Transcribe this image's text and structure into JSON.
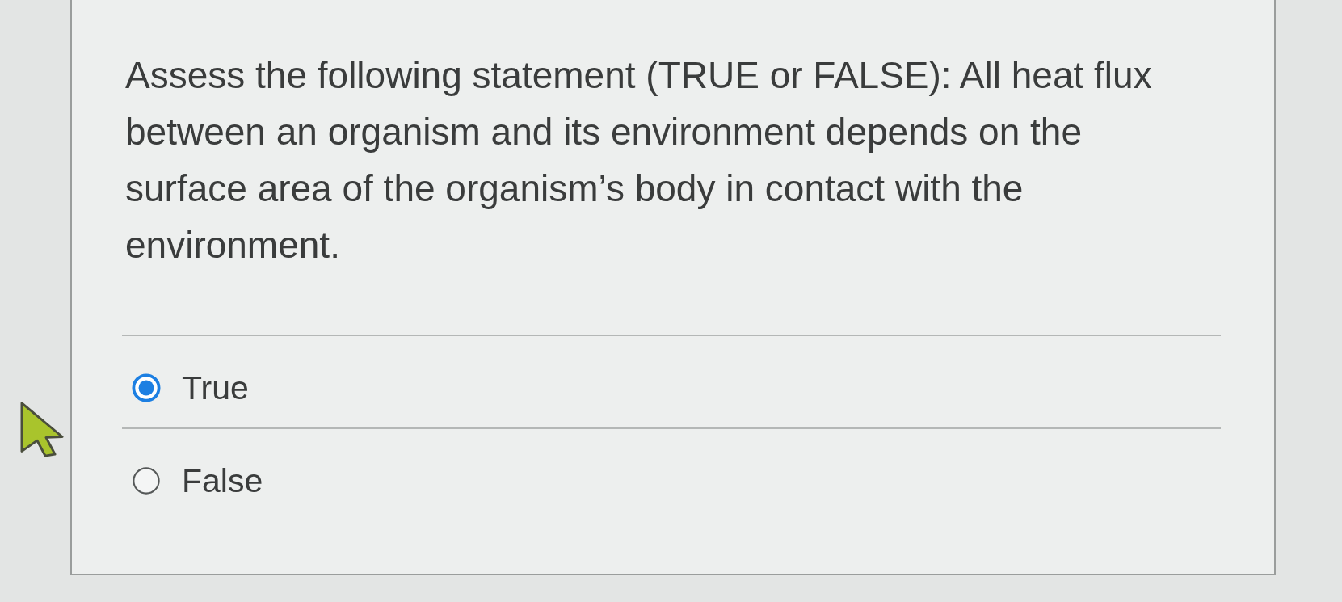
{
  "question": {
    "text": "Assess the following statement (TRUE or FALSE): All heat flux between an organism and its environment depends on the surface area of the organism’s body in contact with the environment."
  },
  "options": [
    {
      "label": "True",
      "selected": true
    },
    {
      "label": "False",
      "selected": false
    }
  ]
}
